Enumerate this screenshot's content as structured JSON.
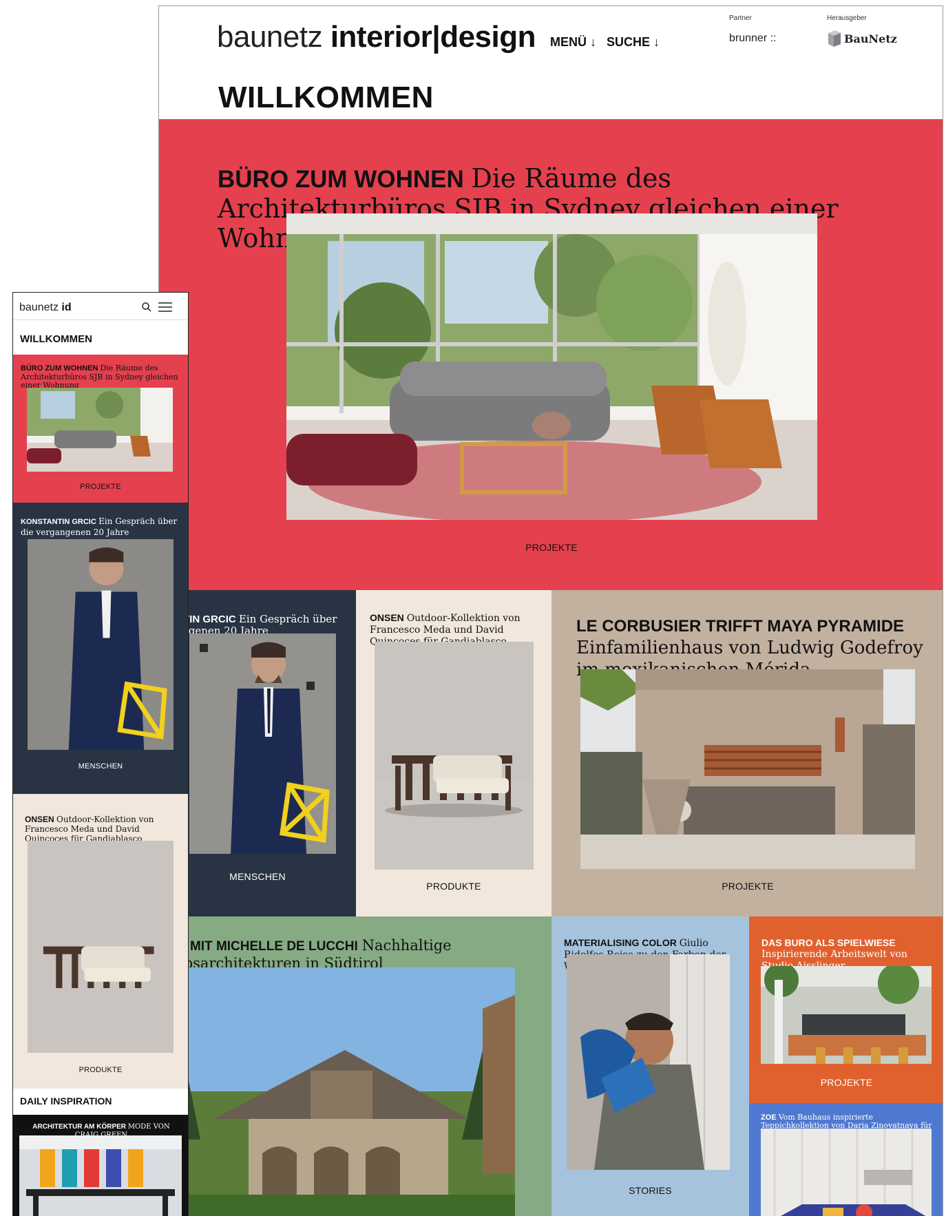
{
  "desktop": {
    "logo": {
      "light": "baunetz ",
      "bold": "interior|design"
    },
    "nav": {
      "menu": "MENÜ",
      "search": "SUCHE",
      "arrow": "↓"
    },
    "partner": {
      "label": "Partner",
      "name": "brunner ::"
    },
    "publisher": {
      "label": "Herausgeber",
      "name": "BauNetz"
    },
    "page_title": "WILLKOMMEN",
    "hero": {
      "kicker": "BÜRO ZUM WOHNEN",
      "text": "Die Räume des Architekturbüros SJB in Sydney gleichen einer Wohnung",
      "category": "PROJEKTE",
      "bg": "#e5404e"
    },
    "tiles": [
      {
        "kicker": "KONSTANTIN GRCIC",
        "text": "Ein Gespräch über die vergangenen 20 Jahre",
        "category": "MENSCHEN",
        "bg": "#283343"
      },
      {
        "kicker": "ONSEN",
        "text": "Outdoor-Kollektion von Francesco Meda und David Quincoces für Gandiablasco",
        "category": "PRODUKTE",
        "bg": "#f1e7dd"
      },
      {
        "kicker": "LE CORBUSIER TRIFFT MAYA PYRAMIDE",
        "text": "Einfamilienhaus von Ludwig Godefroy im mexikanischen Mérida",
        "category": "PROJEKTE",
        "bg": "#c3b1a0"
      },
      {
        "kicker": "FERIEN MIT MICHELLE DE LUCCHI",
        "text": "Nachhaltige Schaubsarchitekturen in Südtirol",
        "bg": "#86aa84"
      },
      {
        "kicker": "MATERIALISING COLOR",
        "text": "Giulio Ridolfos Reise zu den Farben der Welt",
        "category": "STORIES",
        "bg": "#a6c3dd"
      },
      {
        "kicker": "DAS BURO ALS SPIELWIESE",
        "text": "Inspirierende Arbeitswelt von Studio Aisslinger",
        "category": "PROJEKTE",
        "bg": "#e0612e"
      },
      {
        "kicker": "ZOE",
        "text": "Vom Bauhaus inspirierte Teppichkollektion von Daria Zinovatnaya für GAN",
        "bg": "#4f78d1"
      }
    ]
  },
  "mobile": {
    "logo": {
      "light": "baunetz ",
      "bold": "id"
    },
    "page_title": "WILLKOMMEN",
    "cards": [
      {
        "kicker": "BÜRO ZUM WOHNEN",
        "text": "Die Räume des Architekturbüros SJB in Sydney gleichen einer Wohnung",
        "category": "PROJEKTE",
        "bg": "#e5404e"
      },
      {
        "kicker": "KONSTANTIN GRCIC",
        "text": "Ein Gespräch über die vergangenen 20 Jahre",
        "category": "MENSCHEN",
        "bg": "#283343"
      },
      {
        "kicker": "ONSEN",
        "text": "Outdoor-Kollektion von Francesco Meda und David Quincoces für Gandiablasco",
        "category": "PRODUKTE",
        "bg": "#f1e7dd"
      }
    ],
    "daily_title": "DAILY INSPIRATION",
    "daily": {
      "kicker": "ARCHITEKTUR AM KÖRPER",
      "text": "MODE VON CRAIG GREEN"
    }
  }
}
